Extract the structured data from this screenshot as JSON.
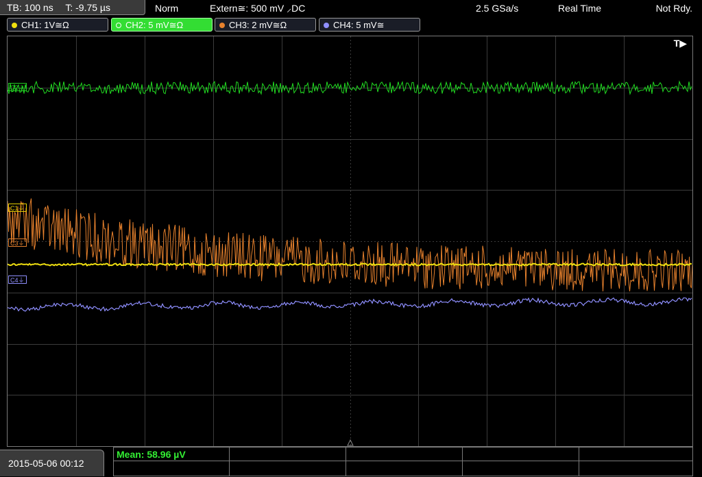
{
  "topbar": {
    "timebase": "TB: 100 ns",
    "trigger_time": "T: -9.75 µs",
    "trigger_mode": "Norm",
    "trigger_source": "Extern≅: 500 mV ⸝DC",
    "sample_rate": "2.5 GSa/s",
    "acquisition": "Real Time",
    "status": "Not Rdy."
  },
  "channels": [
    {
      "label": "CH1: 1V≅Ω",
      "color": "#f0e010"
    },
    {
      "label": "CH2: 5 mV≅Ω",
      "color": "#33dd33"
    },
    {
      "label": "CH3: 2 mV≅Ω",
      "color": "#e8822d"
    },
    {
      "label": "CH4: 5 mV≅",
      "color": "#8f8fff"
    }
  ],
  "screen": {
    "trigger_indicator": "T▶",
    "markers": {
      "c1": "C1⏚",
      "c2": "C2⏚",
      "c3": "C3⏚",
      "c4": "C4⏚"
    }
  },
  "footer": {
    "datetime": "2015-05-06 00:12",
    "measurement": "Mean: 58.96 µV"
  },
  "colors": {
    "ch1": "#f0e010",
    "ch2": "#33dd33",
    "ch3": "#e8822d",
    "ch4": "#8f8fff",
    "grid": "#3c3c3c"
  }
}
